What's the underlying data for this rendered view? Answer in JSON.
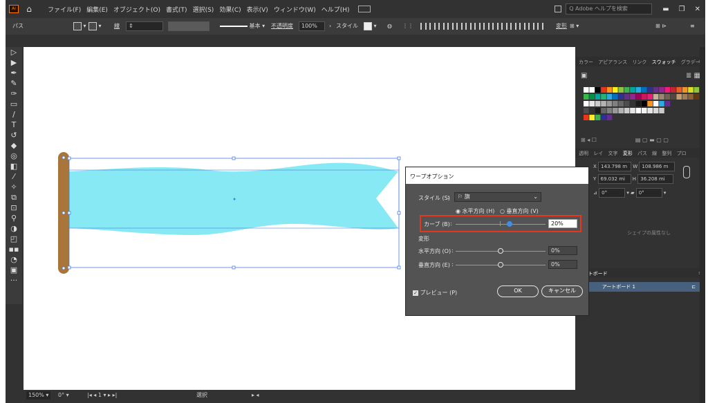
{
  "app": {
    "logo_text": "Ai",
    "home_icon": "home-icon"
  },
  "menu": [
    "ファイル(F)",
    "編集(E)",
    "オブジェクト(O)",
    "書式(T)",
    "選択(S)",
    "効果(C)",
    "表示(V)",
    "ウィンドウ(W)",
    "ヘルプ(H)"
  ],
  "search_placeholder": "Adobe ヘルプを検索",
  "control_bar": {
    "selection_type": "パス",
    "stroke_label": "線",
    "stroke_style": "基本",
    "opacity_label": "不透明度",
    "opacity_value": "100%",
    "style_label": "スタイル",
    "transform_label": "変形"
  },
  "panels": {
    "top_tabs": [
      "カラー",
      "アピアランス",
      "リンク",
      "スウォッチ",
      "グラデーション"
    ],
    "active_top_tab": "スウォッチ",
    "mid_tabs": [
      "透明",
      "レイ",
      "文字",
      "変形",
      "パス",
      "線",
      "整列",
      "プロ"
    ],
    "active_mid_tab": "変形",
    "transform": {
      "x_label": "X",
      "x_value": "143.798 m",
      "w_label": "W",
      "w_value": "108.986 m",
      "y_label": "Y",
      "y_value": "69.032 mi",
      "h_label": "H",
      "h_value": "36.208 mi",
      "angle": "0°",
      "shear": "0°"
    },
    "no_shape_attrs": "シェイプの属性なし",
    "artboards_tab": "アートボード",
    "artboard_number": "1",
    "artboard_name": "アートボード 1"
  },
  "dialog": {
    "title": "ワープオプション",
    "style_label": "スタイル (S)",
    "style_value": "旗",
    "horizontal_label": "水平方向 (H)",
    "vertical_label": "垂直方向 (V)",
    "orientation_selected": "horizontal",
    "bend_label": "カーブ (B)",
    "bend_value": "20%",
    "bend_level": 0.2,
    "distortion_label": "変形",
    "h_dist_label": "水平方向 (O)",
    "h_dist_value": "0%",
    "h_dist_level": 0,
    "v_dist_label": "垂直方向 (E)",
    "v_dist_value": "0%",
    "v_dist_level": 0,
    "preview_label": "プレビュー (P)",
    "preview_checked": true,
    "ok_label": "OK",
    "cancel_label": "キャンセル"
  },
  "status": {
    "zoom": "150%",
    "rotation": "0°",
    "artboard": "1",
    "tool": "選択"
  },
  "colors": {
    "flag": "#86e9f4",
    "pole": "#a8763a",
    "highlight": "#e8361c",
    "accent": "#3c8ee8"
  }
}
